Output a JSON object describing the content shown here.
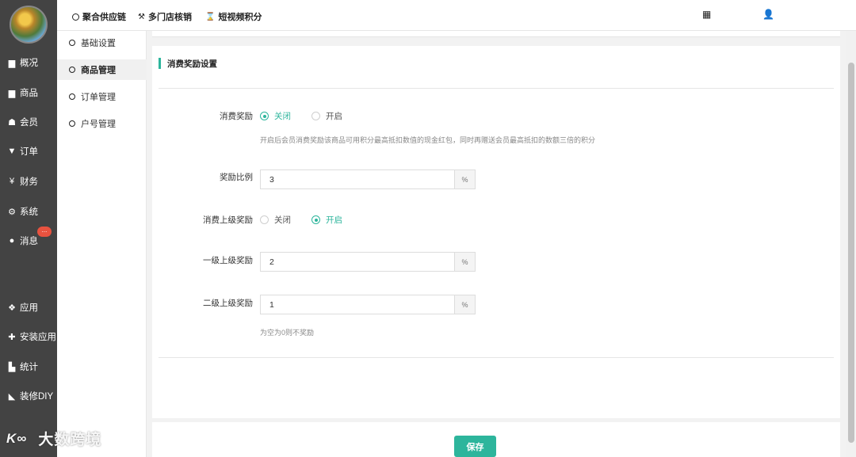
{
  "topbar": {
    "tabs": [
      {
        "label": "聚合供应链",
        "icon": "circle-icon"
      },
      {
        "label": "多门店核销",
        "icon": "gavel-icon"
      },
      {
        "label": "短视频积分",
        "icon": "hourglass-icon"
      }
    ],
    "right_icons": [
      "grid-icon",
      "user-icon"
    ]
  },
  "sidebar": {
    "items": [
      {
        "label": "概况",
        "icon": "overview-icon"
      },
      {
        "label": "商品",
        "icon": "goods-icon"
      },
      {
        "label": "会员",
        "icon": "members-icon"
      },
      {
        "label": "订单",
        "icon": "cart-icon"
      },
      {
        "label": "财务",
        "icon": "yen-icon"
      },
      {
        "label": "系统",
        "icon": "gears-icon"
      },
      {
        "label": "消息",
        "icon": "chat-icon"
      },
      {
        "label": "应用",
        "icon": "apps-icon"
      },
      {
        "label": "安装应用",
        "icon": "puzzle-icon"
      },
      {
        "label": "统计",
        "icon": "bar-chart-icon"
      },
      {
        "label": "装修DIY",
        "icon": "hammer-icon"
      }
    ],
    "message_badge": "..."
  },
  "submenu": {
    "items": [
      {
        "label": "基础设置",
        "active": false
      },
      {
        "label": "商品管理",
        "active": true
      },
      {
        "label": "订单管理",
        "active": false
      },
      {
        "label": "户号管理",
        "active": false
      }
    ]
  },
  "panel": {
    "title": "消费奖励设置",
    "accent_color": "#2db59c",
    "consume_reward": {
      "label": "消费奖励",
      "options": [
        "关闭",
        "开启"
      ],
      "selected": "关闭",
      "help": "开启后会员消费奖励该商品可用积分最高抵扣数值的现金红包，同时再赠送会员最高抵扣的数额三倍的积分"
    },
    "reward_ratio": {
      "label": "奖励比例",
      "value": "3",
      "unit": "%"
    },
    "upline_reward": {
      "label": "消费上级奖励",
      "options": [
        "关闭",
        "开启"
      ],
      "selected": "开启"
    },
    "level1": {
      "label": "一级上级奖励",
      "value": "2",
      "unit": "%"
    },
    "level2": {
      "label": "二级上级奖励",
      "value": "1",
      "unit": "%",
      "help": "为空为0则不奖励"
    },
    "save_label": "保存"
  },
  "watermark": {
    "logo": "K∞",
    "text": "大数跨境"
  }
}
